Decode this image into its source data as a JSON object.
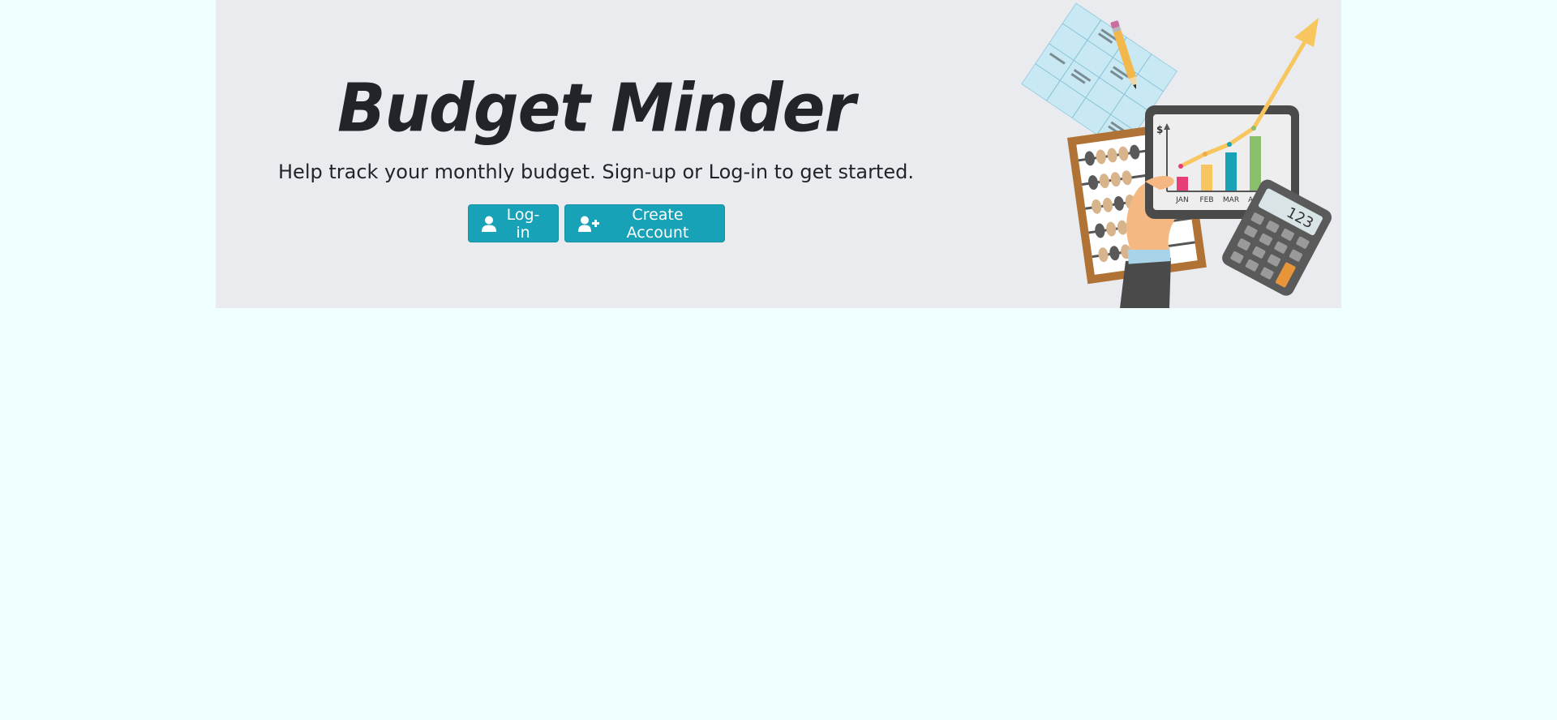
{
  "hero": {
    "title": "Budget Minder",
    "subtitle": "Help track your monthly budget. Sign-up or Log-in to get started.",
    "buttons": {
      "login_label": "Log-in",
      "create_label": "Create Account"
    },
    "illustration": {
      "axis_symbol": "$",
      "months": [
        "JAN",
        "FEB",
        "MAR",
        "APR"
      ],
      "calculator_display": "123"
    }
  },
  "colors": {
    "page_background": "#efffff",
    "hero_background": "#e9ebee",
    "button": "#17a2b8",
    "text": "#212529"
  },
  "icons": {
    "login": "user-icon",
    "create": "user-plus-icon"
  }
}
